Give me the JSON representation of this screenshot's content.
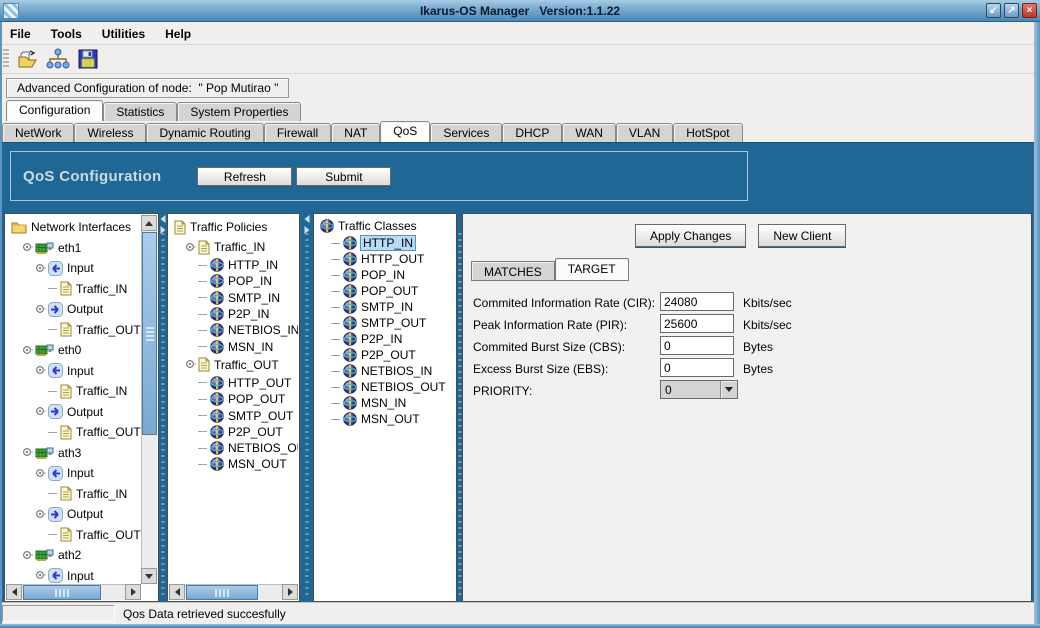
{
  "window": {
    "title": "Ikarus-OS Manager   Version:1.1.22",
    "controls": [
      {
        "name": "minimize",
        "glyph": "↙"
      },
      {
        "name": "maximize",
        "glyph": "↗"
      },
      {
        "name": "close",
        "glyph": "×"
      }
    ]
  },
  "menu": {
    "items": [
      "File",
      "Tools",
      "Utilities",
      "Help"
    ]
  },
  "toolbar": {
    "icons": [
      "open-connection-icon",
      "network-tree-icon",
      "save-icon"
    ]
  },
  "banner": "Advanced Configuration of node:  \" Pop Mutirao \"",
  "top_tabs": {
    "items": [
      "Configuration",
      "Statistics",
      "System Properties"
    ],
    "selected": "Configuration"
  },
  "sub_tabs": {
    "items": [
      "NetWork",
      "Wireless",
      "Dynamic Routing",
      "Firewall",
      "NAT",
      "QoS",
      "Services",
      "DHCP",
      "WAN",
      "VLAN",
      "HotSpot"
    ],
    "selected": "QoS"
  },
  "qos_header": {
    "title": "QoS Configuration",
    "refresh_label": "Refresh",
    "submit_label": "Submit"
  },
  "interfaces_tree": {
    "nodes": [
      {
        "label": "Network Interfaces",
        "icon": "folder",
        "depth": 0,
        "handle": false
      },
      {
        "label": "eth1",
        "icon": "nic",
        "depth": 1,
        "handle": true
      },
      {
        "label": "Input",
        "icon": "input-arrow",
        "depth": 2,
        "handle": true
      },
      {
        "label": "Traffic_IN",
        "icon": "doc",
        "depth": 3,
        "handle": false
      },
      {
        "label": "Output",
        "icon": "output-arrow",
        "depth": 2,
        "handle": true
      },
      {
        "label": "Traffic_OUT",
        "icon": "doc",
        "depth": 3,
        "handle": false
      },
      {
        "label": "eth0",
        "icon": "nic",
        "depth": 1,
        "handle": true
      },
      {
        "label": "Input",
        "icon": "input-arrow",
        "depth": 2,
        "handle": true
      },
      {
        "label": "Traffic_IN",
        "icon": "doc",
        "depth": 3,
        "handle": false
      },
      {
        "label": "Output",
        "icon": "output-arrow",
        "depth": 2,
        "handle": true
      },
      {
        "label": "Traffic_OUT",
        "icon": "doc",
        "depth": 3,
        "handle": false
      },
      {
        "label": "ath3",
        "icon": "nic",
        "depth": 1,
        "handle": true
      },
      {
        "label": "Input",
        "icon": "input-arrow",
        "depth": 2,
        "handle": true
      },
      {
        "label": "Traffic_IN",
        "icon": "doc",
        "depth": 3,
        "handle": false
      },
      {
        "label": "Output",
        "icon": "output-arrow",
        "depth": 2,
        "handle": true
      },
      {
        "label": "Traffic_OUT",
        "icon": "doc",
        "depth": 3,
        "handle": false
      },
      {
        "label": "ath2",
        "icon": "nic",
        "depth": 1,
        "handle": true
      },
      {
        "label": "Input",
        "icon": "input-arrow",
        "depth": 2,
        "handle": true
      }
    ]
  },
  "policies_tree": {
    "nodes": [
      {
        "label": "Traffic Policies",
        "icon": "doc",
        "depth": 0,
        "handle": false
      },
      {
        "label": "Traffic_IN",
        "icon": "doc",
        "depth": 1,
        "handle": true
      },
      {
        "label": "HTTP_IN",
        "icon": "globe",
        "depth": 2,
        "handle": false
      },
      {
        "label": "POP_IN",
        "icon": "globe",
        "depth": 2,
        "handle": false
      },
      {
        "label": "SMTP_IN",
        "icon": "globe",
        "depth": 2,
        "handle": false
      },
      {
        "label": "P2P_IN",
        "icon": "globe",
        "depth": 2,
        "handle": false
      },
      {
        "label": "NETBIOS_IN",
        "icon": "globe",
        "depth": 2,
        "handle": false
      },
      {
        "label": "MSN_IN",
        "icon": "globe",
        "depth": 2,
        "handle": false
      },
      {
        "label": "Traffic_OUT",
        "icon": "doc",
        "depth": 1,
        "handle": true
      },
      {
        "label": "HTTP_OUT",
        "icon": "globe",
        "depth": 2,
        "handle": false
      },
      {
        "label": "POP_OUT",
        "icon": "globe",
        "depth": 2,
        "handle": false
      },
      {
        "label": "SMTP_OUT",
        "icon": "globe",
        "depth": 2,
        "handle": false
      },
      {
        "label": "P2P_OUT",
        "icon": "globe",
        "depth": 2,
        "handle": false
      },
      {
        "label": "NETBIOS_OUT",
        "icon": "globe",
        "depth": 2,
        "handle": false
      },
      {
        "label": "MSN_OUT",
        "icon": "globe",
        "depth": 2,
        "handle": false
      }
    ]
  },
  "classes_tree": {
    "nodes": [
      {
        "label": "Traffic Classes",
        "icon": "globe",
        "depth": 0,
        "handle": false
      },
      {
        "label": "HTTP_IN",
        "icon": "globe",
        "depth": 1,
        "handle": false,
        "selected": true
      },
      {
        "label": "HTTP_OUT",
        "icon": "globe",
        "depth": 1,
        "handle": false
      },
      {
        "label": "POP_IN",
        "icon": "globe",
        "depth": 1,
        "handle": false
      },
      {
        "label": "POP_OUT",
        "icon": "globe",
        "depth": 1,
        "handle": false
      },
      {
        "label": "SMTP_IN",
        "icon": "globe",
        "depth": 1,
        "handle": false
      },
      {
        "label": "SMTP_OUT",
        "icon": "globe",
        "depth": 1,
        "handle": false
      },
      {
        "label": "P2P_IN",
        "icon": "globe",
        "depth": 1,
        "handle": false
      },
      {
        "label": "P2P_OUT",
        "icon": "globe",
        "depth": 1,
        "handle": false
      },
      {
        "label": "NETBIOS_IN",
        "icon": "globe",
        "depth": 1,
        "handle": false
      },
      {
        "label": "NETBIOS_OUT",
        "icon": "globe",
        "depth": 1,
        "handle": false
      },
      {
        "label": "MSN_IN",
        "icon": "globe",
        "depth": 1,
        "handle": false
      },
      {
        "label": "MSN_OUT",
        "icon": "globe",
        "depth": 1,
        "handle": false
      }
    ]
  },
  "detail": {
    "apply_label": "Apply Changes",
    "new_client_label": "New Client",
    "tabs": {
      "items": [
        "MATCHES",
        "TARGET"
      ],
      "selected": "TARGET"
    },
    "fields": [
      {
        "label": "Commited Information Rate (CIR):",
        "value": "24080",
        "unit": "Kbits/sec"
      },
      {
        "label": "Peak Information Rate (PIR):",
        "value": "25600",
        "unit": "Kbits/sec"
      },
      {
        "label": "Commited Burst Size (CBS):",
        "value": "0",
        "unit": "Bytes"
      },
      {
        "label": "Excess Burst Size (EBS):",
        "value": "0",
        "unit": "Bytes"
      }
    ],
    "priority": {
      "label": "PRIORITY:",
      "value": "0"
    }
  },
  "status": {
    "message": "Qos Data retrieved succesfully"
  },
  "colors": {
    "band_blue": "#1f6795",
    "titlebar_top": "#a9cbe3",
    "titlebar_bottom": "#4a86b5",
    "selection_bg": "#b9dcf5",
    "selection_border": "#4f94cd",
    "scroll_thumb": "#8fb9dd"
  }
}
